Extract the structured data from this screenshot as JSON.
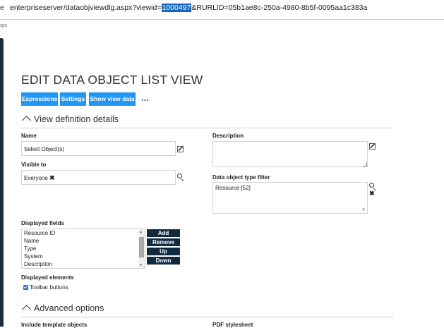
{
  "browser": {
    "left_fragment": "e",
    "url_before": "enterpriseserver/dataobjviewdlg.aspx?viewid=",
    "url_selected": "1000497",
    "url_after": "&RURLID=05b1ae8c-250a-4980-8b5f-0095aa1c383a",
    "apps_fragment": "ıps"
  },
  "page": {
    "title": "EDIT DATA OBJECT LIST VIEW"
  },
  "toolbar": {
    "expressions": "Expressions",
    "settings": "Settings",
    "show_view_data": "Show view data",
    "more": "..."
  },
  "sections": {
    "view_definition": "View definition details",
    "advanced": "Advanced options"
  },
  "form": {
    "name_label": "Name",
    "name_value": "Select Object(s)",
    "description_label": "Description",
    "description_value": "",
    "visible_to_label": "Visible to",
    "visible_to_value": "Everyone",
    "filter_label": "Data object type filter",
    "filter_value": "Resource [52]",
    "displayed_fields_label": "Displayed fields",
    "displayed_fields": [
      "Resource ID",
      "Name",
      "Type",
      "System",
      "Description"
    ],
    "field_buttons": {
      "add": "Add",
      "remove": "Remove",
      "up": "Up",
      "down": "Down"
    },
    "displayed_elements_label": "Displayed elements",
    "toolbar_buttons_label": "Toolbar buttons",
    "toolbar_buttons_checked": true,
    "include_template_label": "Include template objects",
    "pdf_stylesheet_label": "PDF stylesheet"
  },
  "icons": {
    "edit": "edit-icon",
    "search": "search-icon",
    "remove": "x-icon",
    "resize": "resize-grip-icon"
  },
  "colors": {
    "accent_button": "#2196f3",
    "dark_button": "#0f2b3d",
    "selection": "#1565c0"
  }
}
